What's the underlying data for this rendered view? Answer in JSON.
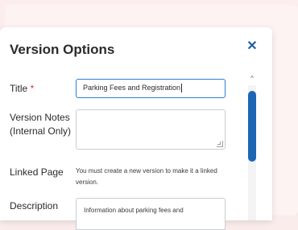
{
  "modal": {
    "title": "Version Options",
    "close_icon": "close-icon"
  },
  "form": {
    "title_label": "Title",
    "required_mark": "*",
    "title_value": "Parking Fees and Registration",
    "notes_label_line1": "Version Notes",
    "notes_label_line2": "(Internal Only)",
    "notes_value": "",
    "linked_label": "Linked Page",
    "linked_text": "You must create a new version to make it a linked version.",
    "description_label": "Description",
    "description_value": "Information about parking fees and"
  },
  "colors": {
    "accent": "#2d7fd0",
    "scrollbar_thumb": "#1d66b3",
    "required": "#d93636"
  }
}
